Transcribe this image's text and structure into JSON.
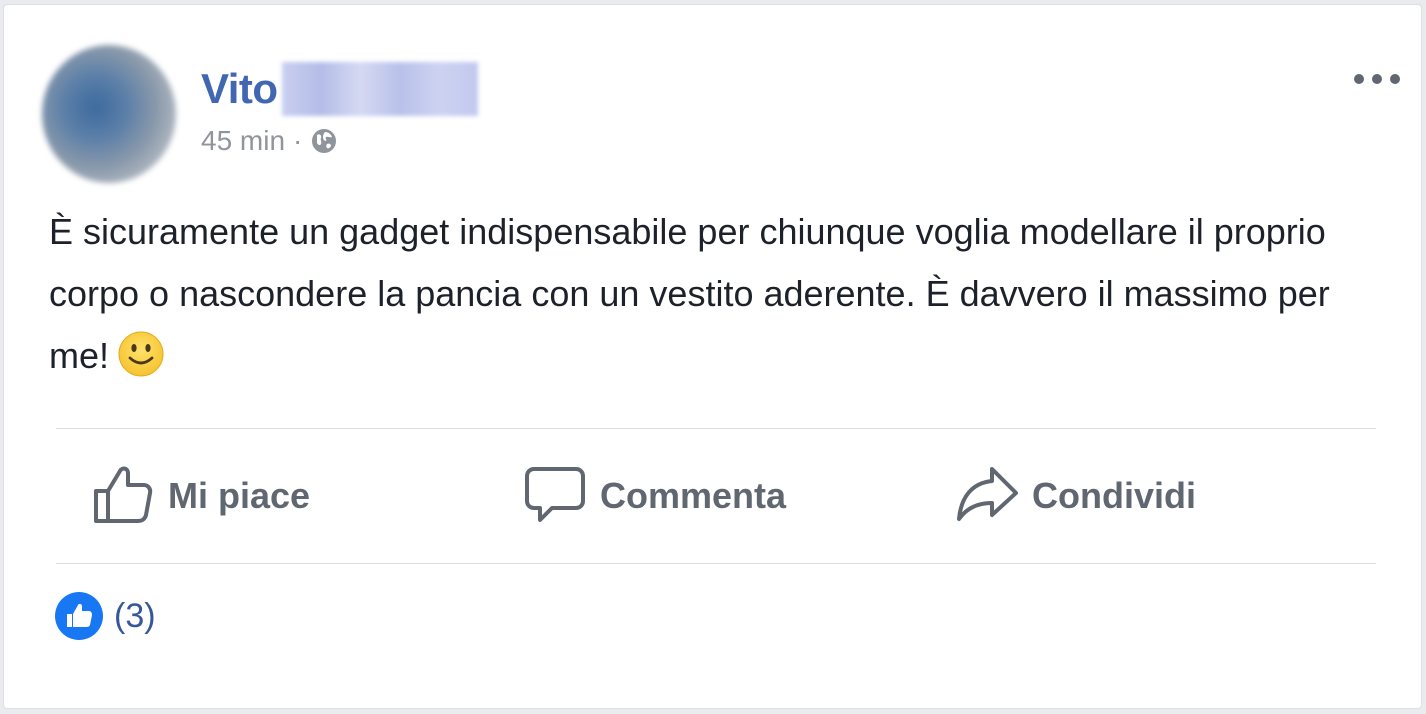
{
  "post": {
    "author_first_name": "Vito",
    "timestamp": "45 min",
    "separator": "·",
    "privacy_icon": "globe-icon",
    "text": "È sicuramente un gadget indispensabile per chiunque voglia modellare il proprio corpo o nascondere la pancia con un vestito aderente. È davvero il massimo per me!",
    "emoji": "slightly-smiling-face"
  },
  "actions": {
    "like_label": "Mi piace",
    "comment_label": "Commenta",
    "share_label": "Condividi"
  },
  "reactions": {
    "count_text": "(3)"
  },
  "colors": {
    "author_name": "#4267b2",
    "action_gray": "#606770",
    "like_blue": "#1877f2",
    "count_blue": "#365899"
  }
}
